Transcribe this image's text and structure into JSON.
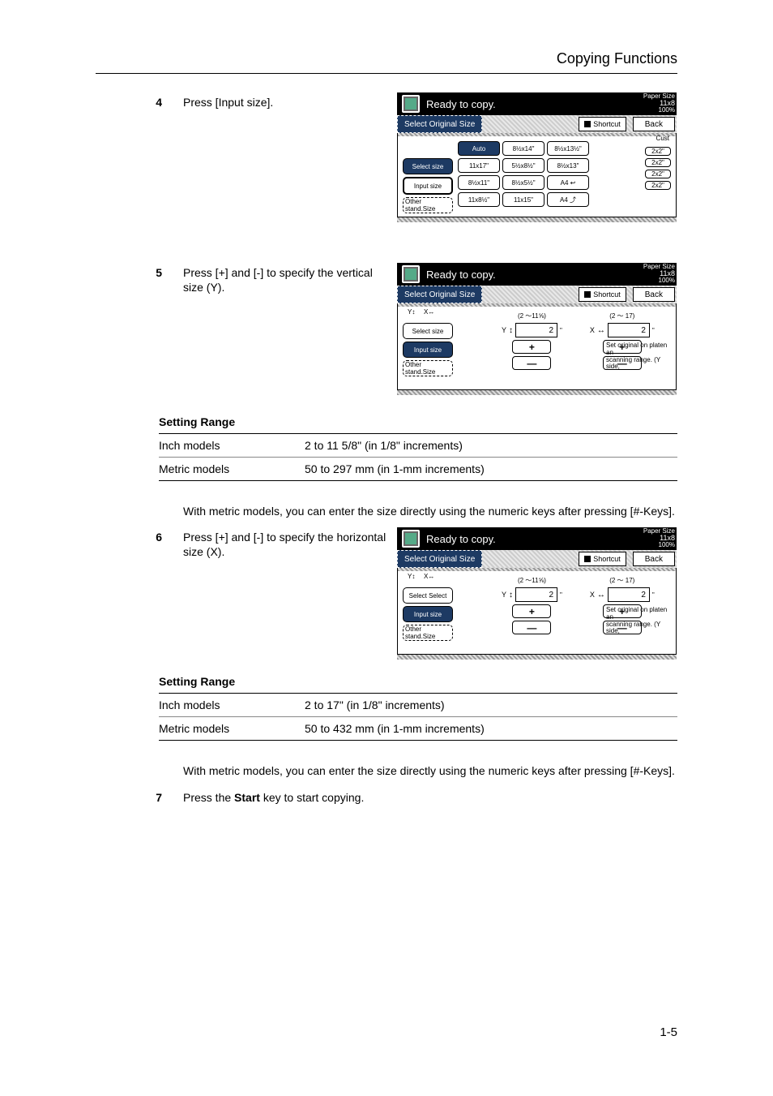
{
  "header": {
    "title": "Copying Functions"
  },
  "page_number": "1-5",
  "steps": {
    "s4_num": "4",
    "s4_text": "Press [Input size].",
    "s5_num": "5",
    "s5_text": "Press [+] and [-] to specify the vertical size (Y).",
    "s6_num": "6",
    "s6_text": "Press [+] and [-] to specify the horizontal size (X).",
    "s7_num": "7",
    "s7_text_a": "Press the ",
    "s7_text_b": "Start",
    "s7_text_c": " key to start copying."
  },
  "screen_common": {
    "ready": "Ready to copy.",
    "paper_size_label": "Paper Size",
    "paper_size_value": "11x8",
    "zoom": "100%",
    "subtitle": "Select Original Size",
    "shortcut": "Shortcut",
    "back": "Back"
  },
  "screen1": {
    "left_tabs": {
      "select": "Select size",
      "input": "Input size",
      "other": "Other stand.Size"
    },
    "grid": {
      "r0c0": "Auto",
      "r0c1": "8½x14\"",
      "r0c2": "8½x13½\"",
      "r1c0": "11x17\"",
      "r1c1": "5½x8½\"",
      "r1c2": "8½x13\"",
      "r2c0": "8½x11\"",
      "r2c1": "8½x5½\"",
      "r2c2": "A4",
      "r2c3_icon": "↩",
      "r3c0": "11x8½\"",
      "r3c1": "11x15\"",
      "r3c2": "A4",
      "r3c3_icon": "⤴"
    },
    "right": {
      "cust": "Cust",
      "btn": "2x2\""
    }
  },
  "screen_input": {
    "left_tabs": {
      "select1": "Select size",
      "select2": "Select Select",
      "input": "Input size",
      "other": "Other stand.Size"
    },
    "y_range": "(2    ～11⅝)",
    "x_range": "(2    ～   17)",
    "y_label": "Y",
    "x_label": "X",
    "y_value": "2",
    "x_value": "2",
    "unit": "\"",
    "plus": "+",
    "minus": "—",
    "note_line1": "Set original on platen an",
    "note_line2": "scanning range. (Y side,"
  },
  "table_y": {
    "title": "Setting Range",
    "r1c1": "Inch models",
    "r1c2": "2 to 11 5/8\" (in 1/8\" increments)",
    "r2c1": "Metric models",
    "r2c2": "50 to 297 mm (in 1-mm increments)"
  },
  "table_x": {
    "title": "Setting Range",
    "r1c1": "Inch models",
    "r1c2": "2 to 17\" (in 1/8\" increments)",
    "r2c1": "Metric models",
    "r2c2": "50 to 432 mm (in 1-mm increments)"
  },
  "notes": {
    "metric": "With metric models, you can enter the size directly using the numeric keys after pressing [#-Keys]."
  }
}
